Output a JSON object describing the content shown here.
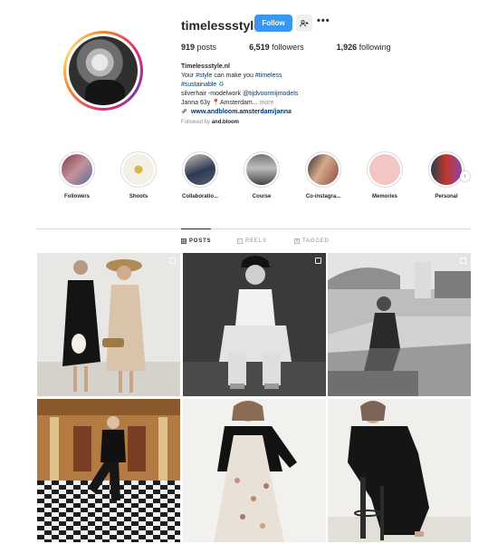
{
  "profile": {
    "username": "timelessstyle.nl",
    "follow_label": "Follow",
    "suggest_icon": "add-person-icon",
    "more_icon": "more-options-icon",
    "posts_count": "919",
    "posts_label": "posts",
    "followers_count": "6,519",
    "followers_label": "followers",
    "following_count": "1,926",
    "following_label": "following",
    "name": "Timelessstyle.nl",
    "bio_line1_prefix": "Your ",
    "bio_line1_tag1": "#style",
    "bio_line1_mid": " can make you ",
    "bio_line1_tag2": "#timeless",
    "bio_line2_tag": "#sustainable",
    "bio_line2_emoji": "♻",
    "bio_line3_prefix": "silverhair -modelwork ",
    "bio_line3_mention": "@tijdvoormijmodels",
    "bio_line4": "Janna 63y",
    "bio_line4_rest": "... ",
    "bio_line4_place": "📍Amsterdam",
    "bio_more": "more",
    "link_icon": "link-icon",
    "link": "www.andbloom.amsterdam/janna",
    "followed_by_prefix": "Followed by ",
    "followed_by_user": "and.bloom"
  },
  "highlights": [
    {
      "label": "Followers",
      "colors": [
        "#7a3b4a",
        "#c4929c",
        "#5b6c8f"
      ]
    },
    {
      "label": "Shoots",
      "colors": [
        "#f3f0e6",
        "#d8b64a",
        "#c9a53f"
      ]
    },
    {
      "label": "Collaboratio...",
      "colors": [
        "#2d3a55",
        "#c9c2b8",
        "#57606f"
      ]
    },
    {
      "label": "Course",
      "colors": [
        "#444444",
        "#bdbdbd",
        "#777777"
      ]
    },
    {
      "label": "Co-instagra...",
      "colors": [
        "#2f2f2f",
        "#d7a98d",
        "#8b4c3e"
      ]
    },
    {
      "label": "Memories",
      "colors": [
        "#f4c5c5",
        "#f7d6d6",
        "#efb7b7"
      ]
    },
    {
      "label": "Personal",
      "colors": [
        "#c0392b",
        "#2c3e50",
        "#8e44ad"
      ]
    }
  ],
  "tabs": [
    {
      "label": "POSTS",
      "icon": "grid-icon",
      "active": true
    },
    {
      "label": "REELS",
      "icon": "reels-icon",
      "active": false
    },
    {
      "label": "TAGGED",
      "icon": "tagged-icon",
      "active": false
    }
  ],
  "posts": [
    {
      "name": "post-two-women-beach-hat",
      "multi": true
    },
    {
      "name": "post-woman-sitting-cap",
      "multi": true
    },
    {
      "name": "post-woman-pool-terrace",
      "multi": true
    },
    {
      "name": "post-woman-checkered-floor",
      "multi": false
    },
    {
      "name": "post-woman-floral-dress",
      "multi": false
    },
    {
      "name": "post-woman-black-dress-chair",
      "multi": false
    }
  ]
}
